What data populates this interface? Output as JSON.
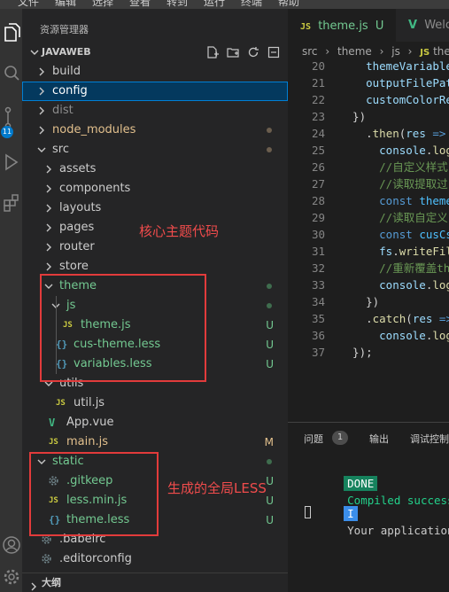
{
  "menubar": {
    "items": [
      "文件",
      "编辑",
      "选择",
      "查看",
      "转到",
      "运行",
      "终端",
      "帮助"
    ]
  },
  "activity": {
    "badge": "11"
  },
  "explorer": {
    "title": "资源管理器",
    "project": "JAVAWEB",
    "items": [
      {
        "label": "build",
        "kind": "folder-closed",
        "color": "#cccccc"
      },
      {
        "label": "config",
        "kind": "folder-closed",
        "color": "#ffffff",
        "selected": true
      },
      {
        "label": "dist",
        "kind": "folder-closed",
        "color": "#8b8b8b"
      },
      {
        "label": "node_modules",
        "kind": "folder-closed",
        "color": "#e2c08d",
        "decoration": "dot",
        "decoration_color": "#6b5e4e"
      },
      {
        "label": "src",
        "kind": "folder-open",
        "color": "#cccccc",
        "decoration": "dot",
        "decoration_color": "#6b5e4e"
      },
      {
        "label": "assets",
        "kind": "folder-closed",
        "color": "#cccccc"
      },
      {
        "label": "components",
        "kind": "folder-closed",
        "color": "#cccccc"
      },
      {
        "label": "layouts",
        "kind": "folder-closed",
        "color": "#cccccc"
      },
      {
        "label": "pages",
        "kind": "folder-closed",
        "color": "#cccccc"
      },
      {
        "label": "router",
        "kind": "folder-closed",
        "color": "#cccccc"
      },
      {
        "label": "store",
        "kind": "folder-closed",
        "color": "#cccccc"
      },
      {
        "label": "theme",
        "kind": "folder-open",
        "color": "#73c991",
        "decoration": "dot",
        "decoration_color": "#3f6d4e"
      },
      {
        "label": "js",
        "kind": "folder-open",
        "color": "#73c991",
        "decoration": "dot",
        "decoration_color": "#3f6d4e"
      },
      {
        "label": "theme.js",
        "kind": "file",
        "file_icon": "JS",
        "icon_color": "#cbcb41",
        "color": "#73c991",
        "status": "U"
      },
      {
        "label": "cus-theme.less",
        "kind": "file",
        "file_icon": "{}",
        "icon_color": "#519aba",
        "color": "#73c991",
        "status": "U"
      },
      {
        "label": "variables.less",
        "kind": "file",
        "file_icon": "{}",
        "icon_color": "#519aba",
        "color": "#73c991",
        "status": "U"
      },
      {
        "label": "utils",
        "kind": "folder-open",
        "color": "#cccccc"
      },
      {
        "label": "util.js",
        "kind": "file",
        "file_icon": "JS",
        "icon_color": "#cbcb41",
        "color": "#cccccc"
      },
      {
        "label": "App.vue",
        "kind": "file",
        "file_icon": "V",
        "icon_color": "#41b883",
        "color": "#cccccc"
      },
      {
        "label": "main.js",
        "kind": "file",
        "file_icon": "JS",
        "icon_color": "#cbcb41",
        "color": "#e2c08d",
        "status": "M",
        "status_color": "#e2c08d"
      },
      {
        "label": "static",
        "kind": "folder-open",
        "color": "#73c991",
        "decoration": "dot",
        "decoration_color": "#3f6d4e"
      },
      {
        "label": ".gitkeep",
        "kind": "file",
        "file_icon": "gear",
        "icon_color": "#6d8086",
        "color": "#73c991",
        "status": "U"
      },
      {
        "label": "less.min.js",
        "kind": "file",
        "file_icon": "JS",
        "icon_color": "#cbcb41",
        "color": "#73c991",
        "status": "U"
      },
      {
        "label": "theme.less",
        "kind": "file",
        "file_icon": "{}",
        "icon_color": "#519aba",
        "color": "#73c991",
        "status": "U"
      },
      {
        "label": ".babelrc",
        "kind": "file",
        "file_icon": "gear",
        "icon_color": "#6d8086",
        "color": "#cccccc"
      },
      {
        "label": ".editorconfig",
        "kind": "file",
        "file_icon": "gear",
        "icon_color": "#6d8086",
        "color": "#cccccc"
      }
    ],
    "annotations": {
      "core": "核心主题代码",
      "generated": "生成的全局LESS"
    },
    "outline": "大纲"
  },
  "editor": {
    "tabs": [
      {
        "icon": "JS",
        "label": "theme.js",
        "status": "U",
        "active": true
      },
      {
        "icon": "V",
        "label": "Welco",
        "active": false
      }
    ],
    "breadcrumb": [
      "src",
      "theme",
      "js",
      "theme"
    ],
    "code_lines": [
      {
        "n": "20",
        "segs": [
          {
            "t": "    ",
            "c": "#d4d4d4"
          },
          {
            "t": "themeVariables,",
            "c": "#9cdcfe"
          }
        ]
      },
      {
        "n": "21",
        "segs": [
          {
            "t": "    ",
            "c": "#d4d4d4"
          },
          {
            "t": "outputFilePath",
            "c": "#9cdcfe"
          }
        ]
      },
      {
        "n": "22",
        "segs": [
          {
            "t": "    ",
            "c": "#d4d4d4"
          },
          {
            "t": "customColorRe",
            "c": "#9cdcfe"
          }
        ]
      },
      {
        "n": "23",
        "segs": [
          {
            "t": "  })",
            "c": "#d4d4d4"
          }
        ]
      },
      {
        "n": "24",
        "segs": [
          {
            "t": "    .",
            "c": "#d4d4d4"
          },
          {
            "t": "then",
            "c": "#dcdcaa"
          },
          {
            "t": "(",
            "c": "#d4d4d4"
          },
          {
            "t": "res",
            "c": "#9cdcfe"
          },
          {
            "t": " => ",
            "c": "#569cd6"
          }
        ]
      },
      {
        "n": "25",
        "segs": [
          {
            "t": "      ",
            "c": "#d4d4d4"
          },
          {
            "t": "console",
            "c": "#9cdcfe"
          },
          {
            "t": ".",
            "c": "#d4d4d4"
          },
          {
            "t": "log",
            "c": "#dcdcaa"
          }
        ]
      },
      {
        "n": "26",
        "segs": [
          {
            "t": "      ",
            "c": "#d4d4d4"
          },
          {
            "t": "//自定义样式",
            "c": "#6a9955"
          }
        ]
      },
      {
        "n": "27",
        "segs": [
          {
            "t": "      ",
            "c": "#d4d4d4"
          },
          {
            "t": "//读取提取过",
            "c": "#6a9955"
          }
        ]
      },
      {
        "n": "28",
        "segs": [
          {
            "t": "      ",
            "c": "#d4d4d4"
          },
          {
            "t": "const ",
            "c": "#569cd6"
          },
          {
            "t": "theme",
            "c": "#4fc1ff"
          }
        ]
      },
      {
        "n": "29",
        "segs": [
          {
            "t": "      ",
            "c": "#d4d4d4"
          },
          {
            "t": "//读取自定义",
            "c": "#6a9955"
          }
        ]
      },
      {
        "n": "30",
        "segs": [
          {
            "t": "      ",
            "c": "#d4d4d4"
          },
          {
            "t": "const ",
            "c": "#569cd6"
          },
          {
            "t": "cusCs",
            "c": "#4fc1ff"
          }
        ]
      },
      {
        "n": "31",
        "segs": [
          {
            "t": "      ",
            "c": "#d4d4d4"
          },
          {
            "t": "fs",
            "c": "#9cdcfe"
          },
          {
            "t": ".",
            "c": "#d4d4d4"
          },
          {
            "t": "writeFil",
            "c": "#dcdcaa"
          }
        ]
      },
      {
        "n": "32",
        "segs": [
          {
            "t": "      ",
            "c": "#d4d4d4"
          },
          {
            "t": "//重新覆盖th",
            "c": "#6a9955"
          }
        ]
      },
      {
        "n": "33",
        "segs": [
          {
            "t": "      ",
            "c": "#d4d4d4"
          },
          {
            "t": "console",
            "c": "#9cdcfe"
          },
          {
            "t": ".",
            "c": "#d4d4d4"
          },
          {
            "t": "log",
            "c": "#dcdcaa"
          }
        ]
      },
      {
        "n": "34",
        "segs": [
          {
            "t": "    })",
            "c": "#d4d4d4"
          }
        ]
      },
      {
        "n": "35",
        "segs": [
          {
            "t": "    .",
            "c": "#d4d4d4"
          },
          {
            "t": "catch",
            "c": "#dcdcaa"
          },
          {
            "t": "(",
            "c": "#d4d4d4"
          },
          {
            "t": "res",
            "c": "#9cdcfe"
          },
          {
            "t": " =>",
            "c": "#569cd6"
          }
        ]
      },
      {
        "n": "36",
        "segs": [
          {
            "t": "      ",
            "c": "#d4d4d4"
          },
          {
            "t": "console",
            "c": "#9cdcfe"
          },
          {
            "t": ".",
            "c": "#d4d4d4"
          },
          {
            "t": "log",
            "c": "#dcdcaa"
          }
        ]
      },
      {
        "n": "37",
        "segs": [
          {
            "t": "  });",
            "c": "#d4d4d4"
          }
        ]
      }
    ]
  },
  "panel": {
    "tabs": {
      "problems": "问题",
      "problems_count": "1",
      "output": "输出",
      "debug": "调试控制"
    },
    "done_badge": "DONE",
    "done_text": "Compiled success",
    "info_badge": "I",
    "info_text": "Your application is",
    "colors": {
      "done_bg": "#16825d",
      "done_text": "#23d18b",
      "info_bg": "#3b8eea"
    }
  }
}
